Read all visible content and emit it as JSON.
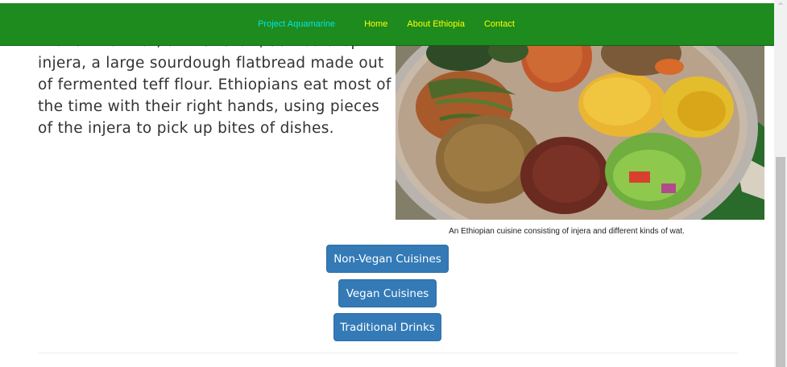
{
  "navbar": {
    "brand": "Project Aquamarine",
    "links": [
      "Home",
      "About Ethiopia",
      "Contact"
    ]
  },
  "content": {
    "lines": [
      "the form of wat, a thick stew, served atop",
      "injera, a large sourdough flatbread made out",
      "of fermented teff flour. Ethiopians eat most of",
      "the time with their right hands, using pieces",
      "of the injera to pick up bites of dishes."
    ]
  },
  "figure": {
    "caption": "An Ethiopian cuisine consisting of injera and different kinds of wat."
  },
  "buttons": {
    "non_vegan": "Non-Vegan Cuisines",
    "vegan": "Vegan Cuisines",
    "drinks": "Traditional Drinks"
  },
  "scrollbar": {
    "up_arrow": "^"
  },
  "colors": {
    "navbar_bg": "#1e8b1e",
    "brand": "#00e5e5",
    "nav_link": "#ffff00",
    "button_bg": "#337ab7"
  }
}
